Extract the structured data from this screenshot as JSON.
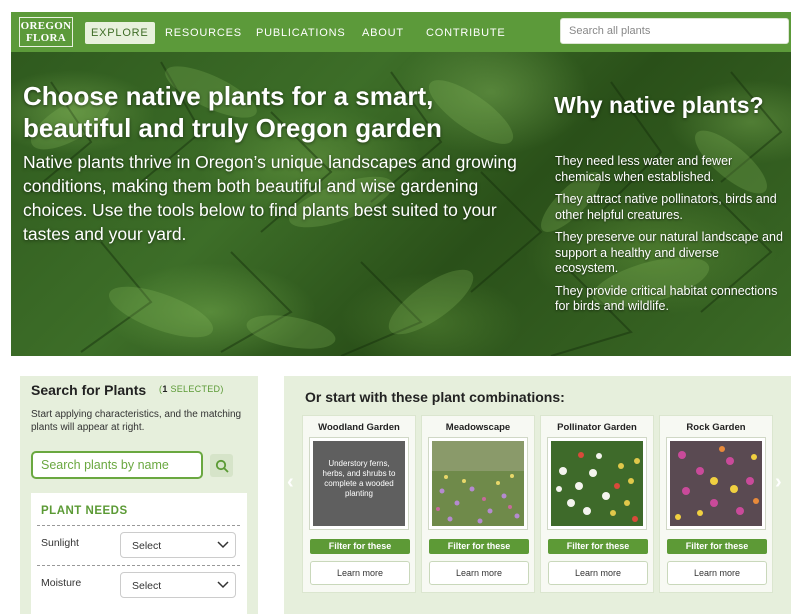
{
  "nav": {
    "logo_line1": "OREGON",
    "logo_line2": "FLORA",
    "items": [
      {
        "label": "EXPLORE",
        "active": true
      },
      {
        "label": "RESOURCES",
        "active": false
      },
      {
        "label": "PUBLICATIONS",
        "active": false
      },
      {
        "label": "ABOUT",
        "active": false
      },
      {
        "label": "CONTRIBUTE",
        "active": false
      }
    ],
    "search_placeholder": "Search all plants"
  },
  "hero": {
    "title": "Choose native plants for a smart, beautiful and truly Oregon garden",
    "text": "Native plants thrive in Oregon’s unique landscapes and growing conditions, making them both beautiful and wise gardening choices. Use the tools below to find plants best suited to your tastes and your yard.",
    "why_title": "Why native plants?",
    "why_items": [
      "They need less water and fewer chemicals when established.",
      "They attract native pollinators, birds and other helpful creatures.",
      "They preserve our natural landscape and support a healthy and diverse ecosystem.",
      "They provide critical habitat connections for birds and wildlife."
    ]
  },
  "search": {
    "title": "Search for Plants",
    "count_number": "1",
    "count_label": "SELECTED",
    "description": "Start applying characteristics, and the matching plants will appear at right.",
    "input_placeholder": "Search plants by name",
    "needs_title": "PLANT NEEDS",
    "needs": [
      {
        "label": "Sunlight",
        "value": "Select"
      },
      {
        "label": "Moisture",
        "value": "Select"
      }
    ]
  },
  "combos": {
    "title": "Or start with these plant combinations:",
    "filter_label": "Filter for these",
    "learn_label": "Learn more",
    "cards": [
      {
        "title": "Woodland Garden",
        "caption": "Understory ferns, herbs, and shrubs to complete a wooded planting"
      },
      {
        "title": "Meadowscape",
        "caption": ""
      },
      {
        "title": "Pollinator Garden",
        "caption": ""
      },
      {
        "title": "Rock Garden",
        "caption": ""
      }
    ]
  },
  "colors": {
    "brand_green": "#5c9a3a",
    "panel_bg": "#e6efdc",
    "accent_green": "#5b9a35"
  }
}
